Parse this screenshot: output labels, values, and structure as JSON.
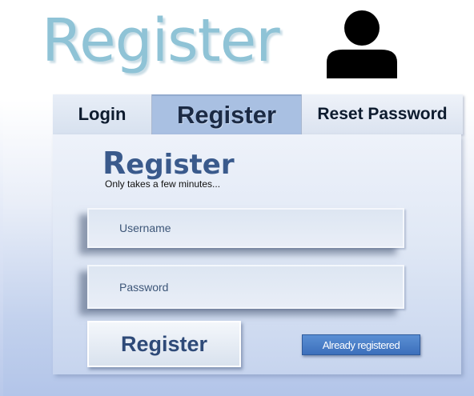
{
  "header": {
    "title": "Register",
    "user_icon": "user-silhouette-icon"
  },
  "tabs": [
    {
      "label": "Login",
      "active": false
    },
    {
      "label": "Register",
      "active": true
    },
    {
      "label": "Reset Password",
      "active": false
    }
  ],
  "form": {
    "heading": "Register",
    "subheading": "Only takes a few minutes...",
    "username": {
      "placeholder": "Username",
      "value": ""
    },
    "password": {
      "placeholder": "Password",
      "value": ""
    },
    "submit_label": "Register",
    "already_registered_label": "Already registered"
  },
  "colors": {
    "title": "#8fc3d6",
    "active_tab": "#a9c0e2",
    "already_button": "#4a7ec8",
    "heading": "#3a5a8c"
  }
}
